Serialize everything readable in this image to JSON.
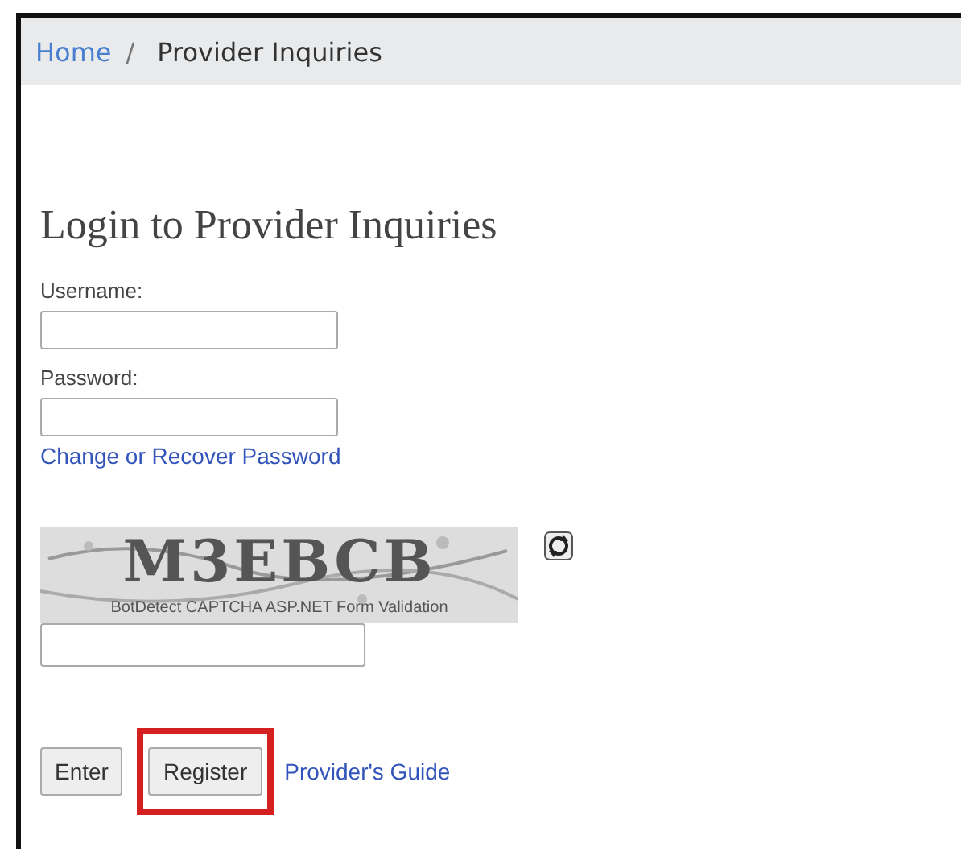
{
  "breadcrumb_separator": "/",
  "breadcrumb": [
    {
      "label": "Home",
      "link": true
    },
    {
      "label": "Provider Inquiries",
      "link": false
    }
  ],
  "title": "Login to Provider Inquiries",
  "fields": [
    {
      "label": "Username:"
    },
    {
      "label": "Password:"
    }
  ],
  "recover_link": "Change or Recover Password",
  "captcha": {
    "code": "M3EBCB",
    "caption": "BotDetect CAPTCHA ASP.NET Form Validation"
  },
  "buttons": [
    {
      "label": "Enter",
      "highlighted": false
    },
    {
      "label": "Register",
      "highlighted": true
    }
  ],
  "guide_link": "Provider's Guide"
}
